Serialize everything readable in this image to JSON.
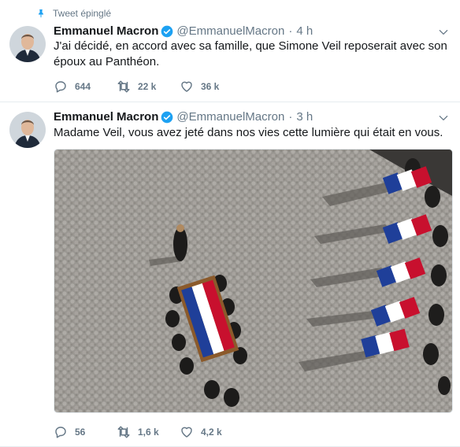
{
  "tweets": [
    {
      "pinned_label": "Tweet épinglé",
      "name": "Emmanuel Macron",
      "handle": "@EmmanuelMacron",
      "separator": "·",
      "time": "4 h",
      "text": "J'ai décidé, en accord avec sa famille, que Simone Veil reposerait avec son époux au Panthéon.",
      "replies": "644",
      "retweets": "22 k",
      "likes": "36 k"
    },
    {
      "name": "Emmanuel Macron",
      "handle": "@EmmanuelMacron",
      "separator": "·",
      "time": "3 h",
      "text": "Madame Veil, vous avez jeté dans nos vies cette lumière qui était en vous.",
      "replies": "56",
      "retweets": "1,6 k",
      "likes": "4,2 k"
    }
  ],
  "colors": {
    "verified": "#1da1f2",
    "pin": "#1da1f2",
    "muted": "#657786",
    "divider": "#e6ecf0"
  },
  "icons": [
    "pin-icon",
    "verified-badge-icon",
    "chevron-down-icon",
    "reply-icon",
    "retweet-icon",
    "like-icon"
  ]
}
